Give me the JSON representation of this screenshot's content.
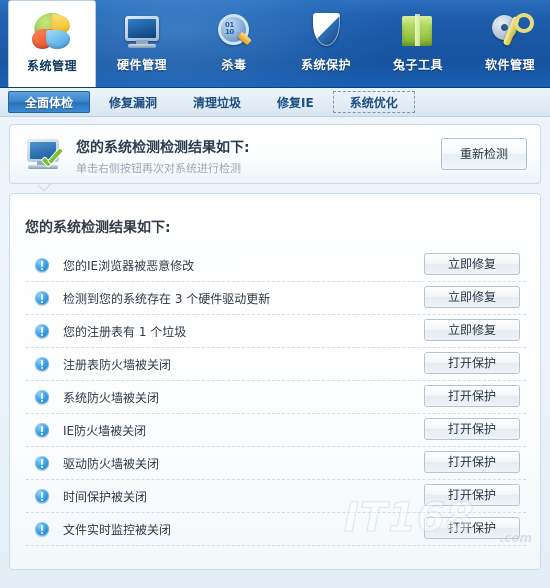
{
  "toolbar": {
    "items": [
      {
        "label": "系统管理",
        "icon": "pie-chart-icon",
        "active": true
      },
      {
        "label": "硬件管理",
        "icon": "monitor-icon",
        "active": false
      },
      {
        "label": "杀毒",
        "icon": "magnifier-icon",
        "active": false
      },
      {
        "label": "系统保护",
        "icon": "shield-icon",
        "active": false
      },
      {
        "label": "兔子工具",
        "icon": "box-icon",
        "active": false
      },
      {
        "label": "软件管理",
        "icon": "gear-wrench-icon",
        "active": false
      }
    ]
  },
  "tabs": [
    {
      "label": "全面体检",
      "selected": true,
      "focused": false
    },
    {
      "label": "修复漏洞",
      "selected": false,
      "focused": false
    },
    {
      "label": "清理垃圾",
      "selected": false,
      "focused": false
    },
    {
      "label": "修复IE",
      "selected": false,
      "focused": false
    },
    {
      "label": "系统优化",
      "selected": false,
      "focused": true
    }
  ],
  "banner": {
    "icon": "monitor-check-icon",
    "title": "您的系统检测检测结果如下:",
    "subtitle": "单击右侧按钮再次对系统进行检测",
    "button_label": "重新检测"
  },
  "panel": {
    "title": "您的系统检测结果如下:",
    "rows": [
      {
        "icon": "info-warning-icon",
        "text": "您的IE浏览器被恶意修改",
        "action": "立即修复"
      },
      {
        "icon": "info-warning-icon",
        "text": "检测到您的系统存在 3 个硬件驱动更新",
        "action": "立即修复"
      },
      {
        "icon": "info-warning-icon",
        "text": "您的注册表有 1 个垃圾",
        "action": "立即修复"
      },
      {
        "icon": "info-warning-icon",
        "text": "注册表防火墙被关闭",
        "action": "打开保护"
      },
      {
        "icon": "info-warning-icon",
        "text": "系统防火墙被关闭",
        "action": "打开保护"
      },
      {
        "icon": "info-warning-icon",
        "text": "IE防火墙被关闭",
        "action": "打开保护"
      },
      {
        "icon": "info-warning-icon",
        "text": "驱动防火墙被关闭",
        "action": "打开保护"
      },
      {
        "icon": "info-warning-icon",
        "text": "时间保护被关闭",
        "action": "打开保护"
      },
      {
        "icon": "info-warning-icon",
        "text": "文件实时监控被关闭",
        "action": "打开保护"
      }
    ]
  },
  "watermark": {
    "text": "IT168",
    "suffix": ".com"
  },
  "colors": {
    "toolbar_blue": "#1a57a4",
    "tab_selected": "#3b84cb",
    "panel_border": "#c8dcea",
    "warning_blue": "#1272bd",
    "text_primary": "#303a45",
    "text_muted": "#9aa8b4"
  }
}
